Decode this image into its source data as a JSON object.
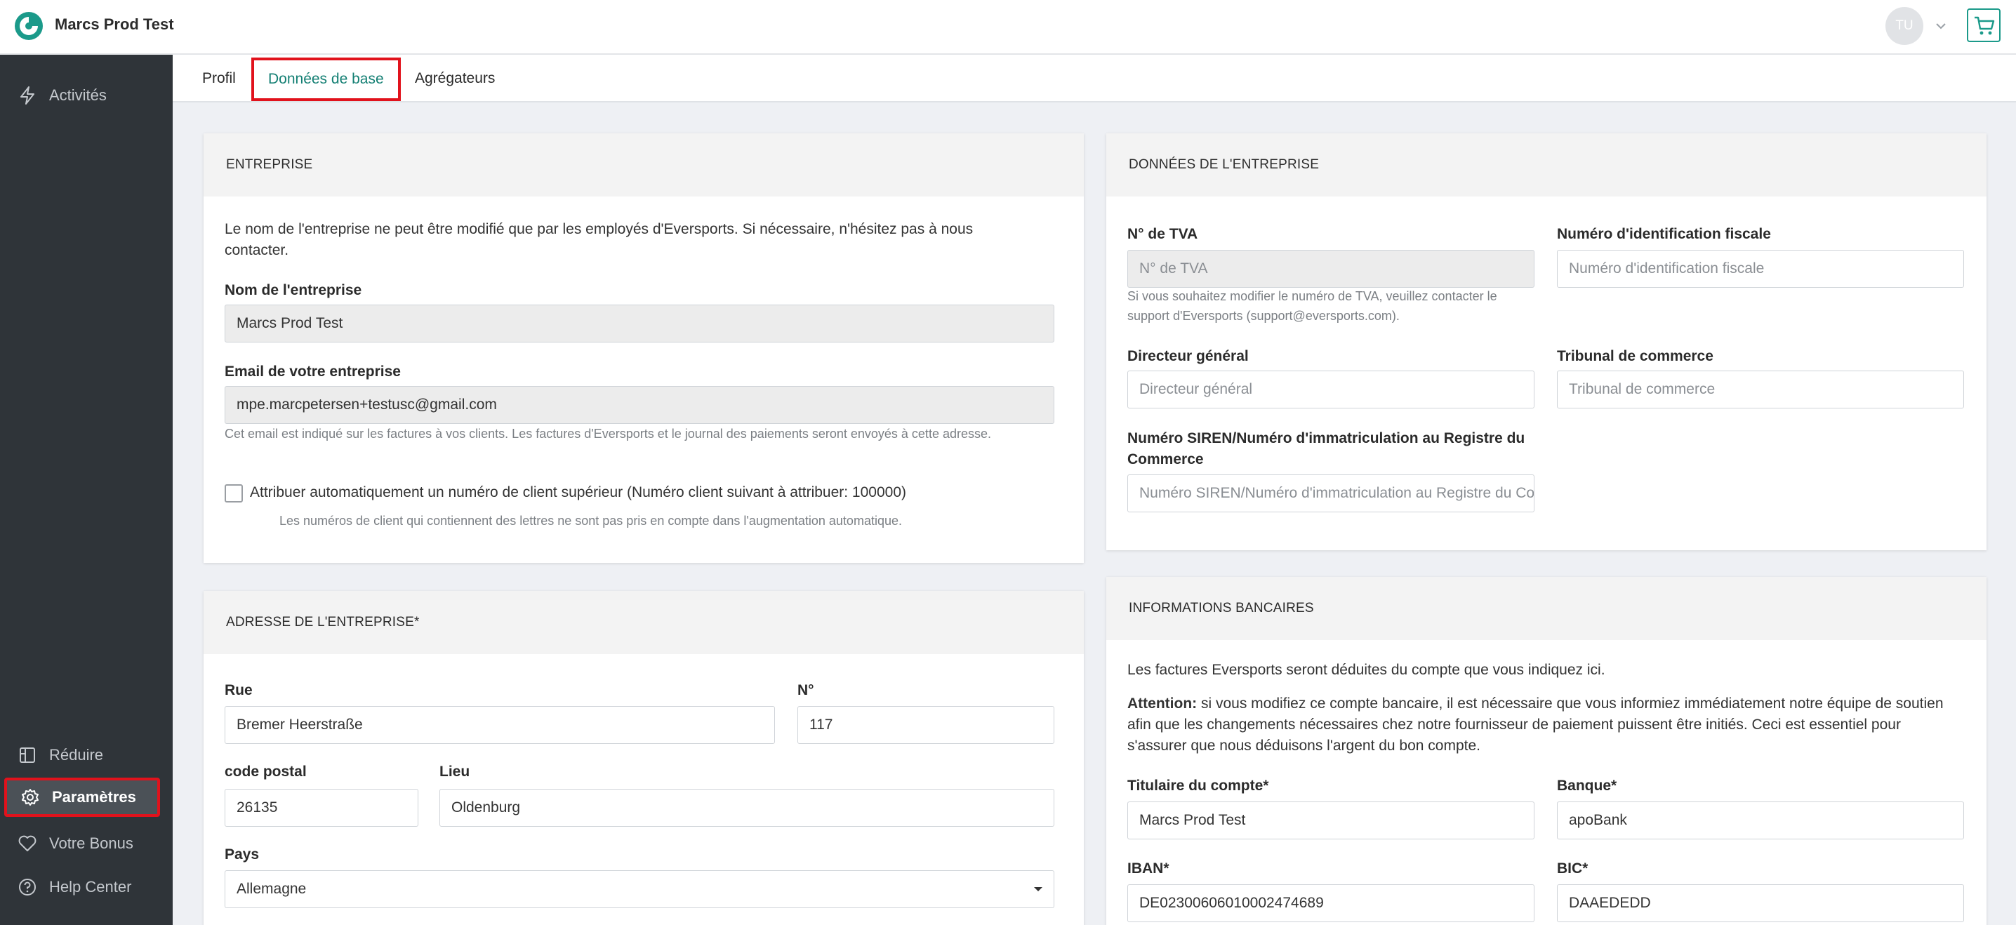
{
  "header": {
    "app_title": "Marcs Prod Test",
    "avatar_initials": "TU",
    "brand_color": "#1b9a8a"
  },
  "sidebar": {
    "items": [
      {
        "label": "Activités",
        "icon": "lightning-icon"
      },
      {
        "label": "Réduire",
        "icon": "collapse-icon"
      },
      {
        "label": "Paramètres",
        "icon": "gear-icon",
        "active": true
      },
      {
        "label": "Votre Bonus",
        "icon": "heart-icon"
      },
      {
        "label": "Help Center",
        "icon": "help-circle-icon"
      }
    ]
  },
  "tabs": [
    {
      "label": "Profil"
    },
    {
      "label": "Données de base",
      "active": true
    },
    {
      "label": "Agrégateurs"
    }
  ],
  "company": {
    "title": "ENTREPRISE",
    "notice": "Le nom de l'entreprise ne peut être modifié que par les employés d'Eversports. Si nécessaire, n'hésitez pas à nous contacter.",
    "name_label": "Nom de l'entreprise",
    "name_value": "Marcs Prod Test",
    "email_label": "Email de votre entreprise",
    "email_value": "mpe.marcpetersen+testusc@gmail.com",
    "email_help": "Cet email est indiqué sur les factures à vos clients. Les factures d'Eversports et le journal des paiements seront envoyés à cette adresse.",
    "auto_number_label": "Attribuer automatiquement un numéro de client supérieur (Numéro client suivant à attribuer: 100000)",
    "auto_number_help": "Les numéros de client qui contiennent des lettres ne sont pas pris en compte dans l'augmentation automatique."
  },
  "address": {
    "title": "ADRESSE DE L'ENTREPRISE*",
    "street_label": "Rue",
    "street_value": "Bremer Heerstraße",
    "number_label": "N°",
    "number_value": "117",
    "zip_label": "code postal",
    "zip_value": "26135",
    "city_label": "Lieu",
    "city_value": "Oldenburg",
    "country_label": "Pays",
    "country_value": "Allemagne"
  },
  "company_data": {
    "title": "DONNÉES DE L'ENTREPRISE",
    "vat_label": "N° de TVA",
    "vat_placeholder": "N° de TVA",
    "vat_help": "Si vous souhaitez modifier le numéro de TVA, veuillez contacter le support d'Eversports (support@eversports.com).",
    "tax_label": "Numéro d'identification fiscale",
    "tax_placeholder": "Numéro d'identification fiscale",
    "ceo_label": "Directeur général",
    "ceo_placeholder": "Directeur général",
    "court_label": "Tribunal de commerce",
    "court_placeholder": "Tribunal de commerce",
    "siren_label": "Numéro SIREN/Numéro d'immatriculation au Registre du Commerce",
    "siren_placeholder": "Numéro SIREN/Numéro d'immatriculation au Registre du Commerce"
  },
  "bank": {
    "title": "INFORMATIONS BANCAIRES",
    "intro": "Les factures Eversports seront déduites du compte que vous indiquez ici.",
    "attention_label": "Attention:",
    "attention_text": " si vous modifiez ce compte bancaire, il est nécessaire que vous informiez immédiatement notre équipe de soutien afin que les changements nécessaires chez notre fournisseur de paiement puissent être initiés. Ceci est essentiel pour s'assurer que nous déduisons l'argent du bon compte.",
    "holder_label": "Titulaire du compte*",
    "holder_value": "Marcs Prod Test",
    "bank_label": "Banque*",
    "bank_value": "apoBank",
    "iban_label": "IBAN*",
    "iban_value": "DE02300606010002474689",
    "bic_label": "BIC*",
    "bic_value": "DAAEDEDD"
  }
}
